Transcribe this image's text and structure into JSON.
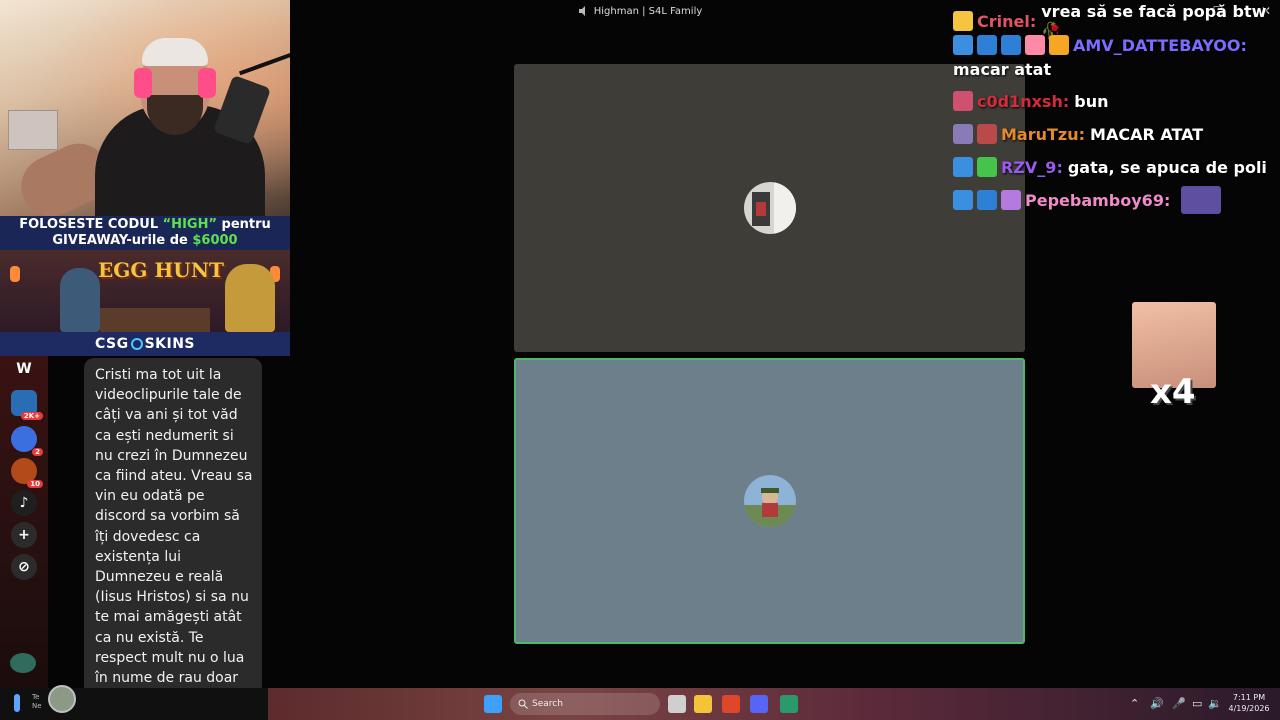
{
  "window": {
    "title": "Highman | S4L Family",
    "minimize": "—",
    "maximize": "☐",
    "close": "✕"
  },
  "promo": {
    "line1_a": "FOLOSESTE CODUL ",
    "line1_code": "“HIGH”",
    "line1_b": " pentru",
    "line2_a": "GIVEAWAY-urile de ",
    "line2_amount": "$6000"
  },
  "game_banner": {
    "title": "EGG HUNT"
  },
  "sponsor": {
    "brand_a": "CSG",
    "brand_b": "SKINS"
  },
  "servers": [
    {
      "label": "W",
      "color": "#000000",
      "count": ""
    },
    {
      "label": "",
      "color": "#2b6db4",
      "count": "2K+"
    },
    {
      "label": "",
      "color": "#3b6fe0",
      "count": "2"
    },
    {
      "label": "",
      "color": "#b24a1a",
      "count": "10"
    },
    {
      "label": "♪",
      "color": "#1f1f1f",
      "count": ""
    },
    {
      "label": "+",
      "color": "#2b2b2b",
      "count": ""
    },
    {
      "label": "⊘",
      "color": "#2b2b2b",
      "count": ""
    }
  ],
  "donation": {
    "text": "Cristi ma tot uit la videoclipurile tale de câți va ani și tot văd ca ești nedumerit si nu crezi în Dumnezeu ca fiind ateu. Vreau sa vin eu odată pe discord sa vorbim să îți dovedesc ca existența lui Dumnezeu e reală (Iisus Hristos) si sa nu te mai amăgești atât ca nu există. Te respect mult nu o lua în nume de rau doar vreau să-ți dovedesc ca te înșeli. Love you 🫶"
  },
  "chat": [
    {
      "user": "Crinel:",
      "user_color": "#e0555f",
      "text": "vrea să se facă popă btw 🥀",
      "badges": [
        "#f5c542"
      ]
    },
    {
      "user": "AMV_DATTEBAYOO:",
      "user_color": "#7a6cff",
      "text": "",
      "badges": [
        "#3a8fe0",
        "#2e7fd6",
        "#2e7fd6",
        "#ff8aa8",
        "#f5a623"
      ]
    },
    {
      "user": "",
      "user_color": "#ffffff",
      "text": "macar atat",
      "badges": []
    },
    {
      "user": "c0d1nxsh:",
      "user_color": "#d62b3a",
      "text": "bun",
      "badges": [
        "#d05070"
      ]
    },
    {
      "user": "MaruTzu:",
      "user_color": "#e58a2c",
      "text": "MACAR ATAT",
      "badges": [
        "#8a7ab8",
        "#b84a4a"
      ]
    },
    {
      "user": "RZV_9:",
      "user_color": "#9a5af0",
      "text": "gata, se apuca de poli",
      "badges": [
        "#3a8fe0",
        "#46c44a"
      ]
    },
    {
      "user": "Pepebamboy69:",
      "user_color": "#f08ac8",
      "text": "",
      "badges": [
        "#3a8fe0",
        "#2e7fd6",
        "#b57ae0"
      ]
    }
  ],
  "reaction": {
    "count": "x4"
  },
  "weather": {
    "line1": "Te",
    "line2": "Ne"
  },
  "taskbar": {
    "search_placeholder": "Search",
    "time": "7:11 PM",
    "date": "4/19/2026"
  }
}
